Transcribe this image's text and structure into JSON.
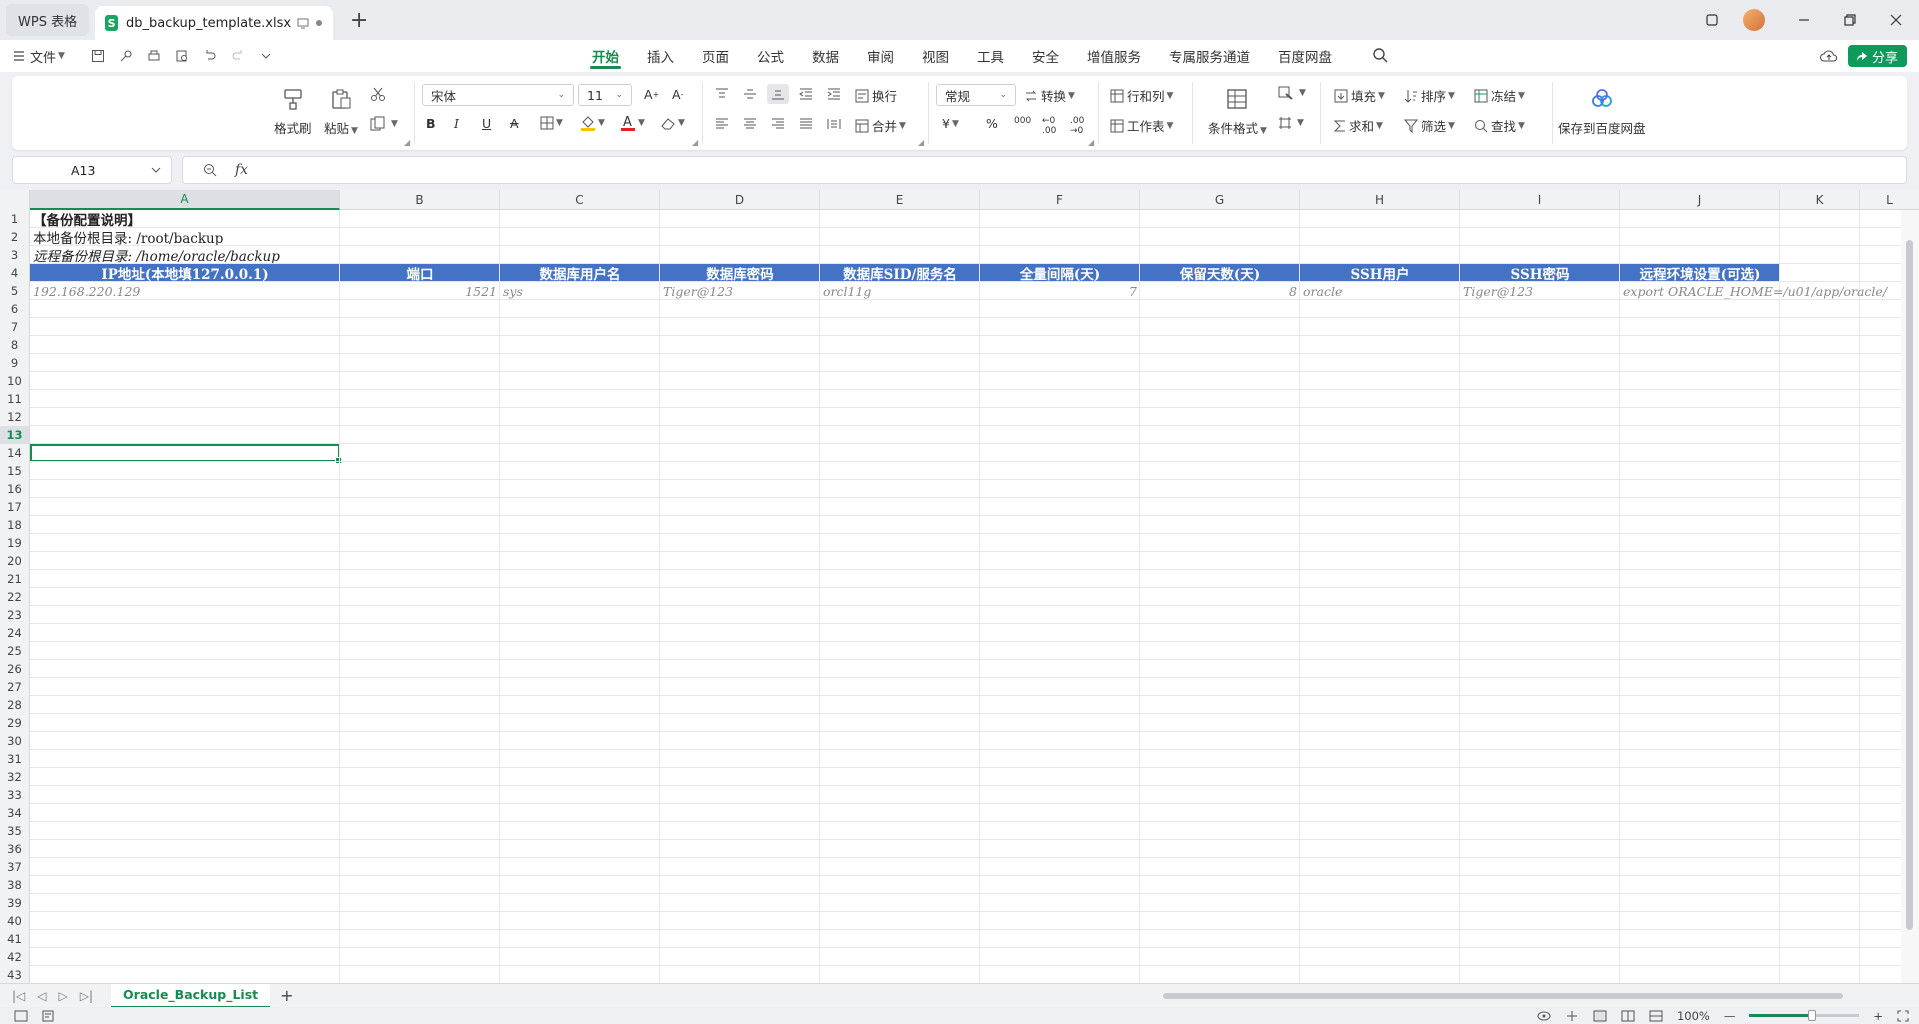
{
  "titlebar": {
    "app_tab": "WPS 表格",
    "doc_tab": "db_backup_template.xlsx",
    "new_tab": "+"
  },
  "menubar": {
    "file_label": "文件",
    "tabs": [
      "开始",
      "插入",
      "页面",
      "公式",
      "数据",
      "审阅",
      "视图",
      "工具",
      "安全",
      "增值服务",
      "专属服务通道",
      "百度网盘"
    ],
    "active_tab": "开始",
    "share_label": "分享"
  },
  "ribbon": {
    "format_painter": "格式刷",
    "paste": "粘贴",
    "font_name": "宋体",
    "font_size": "11",
    "wrap": "换行",
    "merge": "合并",
    "number_format": "常规",
    "convert": "转换",
    "row_col": "行和列",
    "worksheet": "工作表",
    "conditional_format": "条件格式",
    "fill": "填充",
    "sort": "排序",
    "freeze": "冻结",
    "sum": "求和",
    "filter": "筛选",
    "find": "查找",
    "save_baidu": "保存到百度网盘",
    "currency": "¥",
    "percent": "%",
    "thousands": "000"
  },
  "formulabar": {
    "cell_ref": "A13",
    "fx": "fx",
    "value": ""
  },
  "sheet": {
    "columns": [
      "A",
      "B",
      "C",
      "D",
      "E",
      "F",
      "G",
      "H",
      "I",
      "J",
      "K",
      "L"
    ],
    "selected_column": "A",
    "selected_row": 13,
    "notes": {
      "title": "【备份配置说明】",
      "local_dir": "本地备份根目录: /root/backup",
      "remote_dir": "远程备份根目录: /home/oracle/backup"
    },
    "headers": [
      "IP地址(本地填127.0.0.1)",
      "端口",
      "数据库用户名",
      "数据库密码",
      "数据库SID/服务名",
      "全量间隔(天)",
      "保留天数(天)",
      "SSH用户",
      "SSH密码",
      "远程环境设置(可选)"
    ],
    "row5": [
      "192.168.220.129",
      "1521",
      "sys",
      "Tiger@123",
      "orcl11g",
      "7",
      "8",
      "oracle",
      "Tiger@123",
      "export ORACLE_HOME=/u01/app/oracle/"
    ],
    "header_color": "#4472c4"
  },
  "sheetbar": {
    "sheet_name": "Oracle_Backup_List",
    "add": "+"
  },
  "statusbar": {
    "zoom": "100%"
  }
}
